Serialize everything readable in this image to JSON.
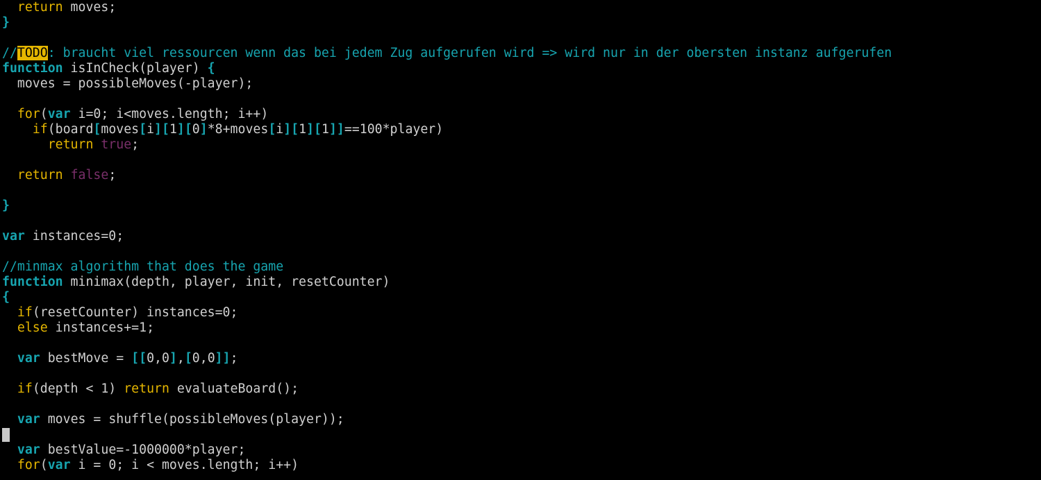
{
  "editor": {
    "colors": {
      "background": "#000000",
      "text": "#d0d0d0",
      "keyword": "#e5b600",
      "type": "#17a5b0",
      "bracket": "#17a5b0",
      "boolean": "#7a2f6a",
      "comment": "#17a5b0",
      "todo_highlight": "#e5b600",
      "cursor": "#c8c8c8"
    },
    "lines": [
      [
        {
          "t": "  ",
          "c": "tx"
        },
        {
          "t": "return",
          "c": "kw"
        },
        {
          "t": " moves;",
          "c": "tx"
        }
      ],
      [
        {
          "t": "}",
          "c": "br"
        }
      ],
      [],
      [
        {
          "t": "//",
          "c": "cm"
        },
        {
          "t": "TODO",
          "c": "todo"
        },
        {
          "t": ": braucht viel ressourcen wenn das bei jedem Zug aufgerufen wird => wird nur in der obersten instanz aufgerufen",
          "c": "cm"
        }
      ],
      [
        {
          "t": "function",
          "c": "fn"
        },
        {
          "t": " isInCheck(player) ",
          "c": "tx"
        },
        {
          "t": "{",
          "c": "br"
        }
      ],
      [
        {
          "t": "  moves = possibleMoves(-player);",
          "c": "tx"
        }
      ],
      [],
      [
        {
          "t": "  ",
          "c": "tx"
        },
        {
          "t": "for",
          "c": "kw"
        },
        {
          "t": "(",
          "c": "tx"
        },
        {
          "t": "var",
          "c": "fn"
        },
        {
          "t": " i=0; i<moves.length; i++)",
          "c": "tx"
        }
      ],
      [
        {
          "t": "    ",
          "c": "tx"
        },
        {
          "t": "if",
          "c": "kw"
        },
        {
          "t": "(board",
          "c": "tx"
        },
        {
          "t": "[",
          "c": "br"
        },
        {
          "t": "moves",
          "c": "tx"
        },
        {
          "t": "[",
          "c": "br"
        },
        {
          "t": "i",
          "c": "tx"
        },
        {
          "t": "][",
          "c": "br"
        },
        {
          "t": "1",
          "c": "tx"
        },
        {
          "t": "][",
          "c": "br"
        },
        {
          "t": "0",
          "c": "tx"
        },
        {
          "t": "]",
          "c": "br"
        },
        {
          "t": "*8+moves",
          "c": "tx"
        },
        {
          "t": "[",
          "c": "br"
        },
        {
          "t": "i",
          "c": "tx"
        },
        {
          "t": "][",
          "c": "br"
        },
        {
          "t": "1",
          "c": "tx"
        },
        {
          "t": "][",
          "c": "br"
        },
        {
          "t": "1",
          "c": "tx"
        },
        {
          "t": "]]",
          "c": "br"
        },
        {
          "t": "==100*player)",
          "c": "tx"
        }
      ],
      [
        {
          "t": "      ",
          "c": "tx"
        },
        {
          "t": "return",
          "c": "kw"
        },
        {
          "t": " ",
          "c": "tx"
        },
        {
          "t": "true",
          "c": "bool"
        },
        {
          "t": ";",
          "c": "tx"
        }
      ],
      [],
      [
        {
          "t": "  ",
          "c": "tx"
        },
        {
          "t": "return",
          "c": "kw"
        },
        {
          "t": " ",
          "c": "tx"
        },
        {
          "t": "false",
          "c": "bool"
        },
        {
          "t": ";",
          "c": "tx"
        }
      ],
      [],
      [
        {
          "t": "}",
          "c": "br"
        }
      ],
      [],
      [
        {
          "t": "var",
          "c": "fn"
        },
        {
          "t": " instances=0;",
          "c": "tx"
        }
      ],
      [],
      [
        {
          "t": "//minmax algorithm that does the game",
          "c": "cm"
        }
      ],
      [
        {
          "t": "function",
          "c": "fn"
        },
        {
          "t": " minimax(depth, player, init, resetCounter)",
          "c": "tx"
        }
      ],
      [
        {
          "t": "{",
          "c": "br"
        }
      ],
      [
        {
          "t": "  ",
          "c": "tx"
        },
        {
          "t": "if",
          "c": "kw"
        },
        {
          "t": "(resetCounter) instances=0;",
          "c": "tx"
        }
      ],
      [
        {
          "t": "  ",
          "c": "tx"
        },
        {
          "t": "else",
          "c": "kw"
        },
        {
          "t": " instances+=1;",
          "c": "tx"
        }
      ],
      [],
      [
        {
          "t": "  ",
          "c": "tx"
        },
        {
          "t": "var",
          "c": "fn"
        },
        {
          "t": " bestMove = ",
          "c": "tx"
        },
        {
          "t": "[[",
          "c": "br"
        },
        {
          "t": "0,0",
          "c": "tx"
        },
        {
          "t": "]",
          "c": "br"
        },
        {
          "t": ",",
          "c": "tx"
        },
        {
          "t": "[",
          "c": "br"
        },
        {
          "t": "0,0",
          "c": "tx"
        },
        {
          "t": "]]",
          "c": "br"
        },
        {
          "t": ";",
          "c": "tx"
        }
      ],
      [],
      [
        {
          "t": "  ",
          "c": "tx"
        },
        {
          "t": "if",
          "c": "kw"
        },
        {
          "t": "(depth < 1) ",
          "c": "tx"
        },
        {
          "t": "return",
          "c": "kw"
        },
        {
          "t": " evaluateBoard();",
          "c": "tx"
        }
      ],
      [],
      [
        {
          "t": "  ",
          "c": "tx"
        },
        {
          "t": "var",
          "c": "fn"
        },
        {
          "t": " moves = shuffle(possibleMoves(player));",
          "c": "tx"
        }
      ],
      [
        {
          "t": "",
          "c": "cursor"
        }
      ],
      [
        {
          "t": "  ",
          "c": "tx"
        },
        {
          "t": "var",
          "c": "fn"
        },
        {
          "t": " bestValue=-1000000*player;",
          "c": "tx"
        }
      ],
      [
        {
          "t": "  ",
          "c": "tx"
        },
        {
          "t": "for",
          "c": "kw"
        },
        {
          "t": "(",
          "c": "tx"
        },
        {
          "t": "var",
          "c": "fn"
        },
        {
          "t": " i = 0; i < moves.length; i++)",
          "c": "tx"
        }
      ]
    ]
  }
}
